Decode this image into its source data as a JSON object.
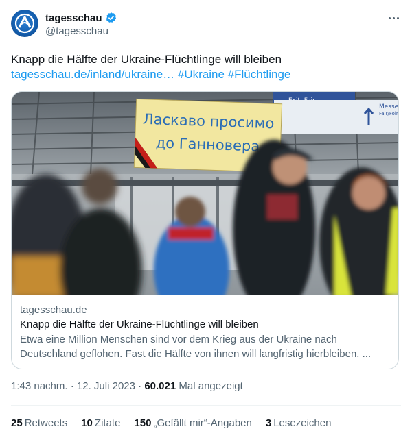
{
  "author": {
    "name": "tagesschau",
    "handle": "@tagesschau",
    "verified": true,
    "avatar_icon": "tagesschau-logo-icon",
    "verified_icon": "verified-badge-icon",
    "accent": "#1d9bf0"
  },
  "tweet": {
    "text": "Knapp die Hälfte der Ukraine-Flüchtlinge will bleiben",
    "link_text": "tagesschau.de/inland/ukraine…",
    "hashtags": [
      "#Ukraine",
      "#Flüchtlinge"
    ]
  },
  "card": {
    "image": {
      "banner_line1": "Ласкаво просимо",
      "banner_line2": "до Ганновера",
      "sign_left": "Exit, Fair",
      "sign_right_1": "Messe, S",
      "sign_right_2": "Fair/Foire"
    },
    "domain": "tagesschau.de",
    "title": "Knapp die Hälfte der Ukraine-Flüchtlinge will bleiben",
    "description_line1": "Etwa eine Million Menschen sind vor dem Krieg aus der Ukraine nach",
    "description_line2": "Deutschland geflohen. Fast die Hälfte von ihnen will langfristig hierbleiben. ..."
  },
  "meta": {
    "time": "1:43 nachm.",
    "separator": "·",
    "date": "12. Juli 2023",
    "views_count": "60.021",
    "views_label": "Mal angezeigt"
  },
  "stats": [
    {
      "count": "25",
      "label": "Retweets"
    },
    {
      "count": "10",
      "label": "Zitate"
    },
    {
      "count": "150",
      "label": "„Gefällt mir“-Angaben"
    },
    {
      "count": "3",
      "label": "Lesezeichen"
    }
  ]
}
